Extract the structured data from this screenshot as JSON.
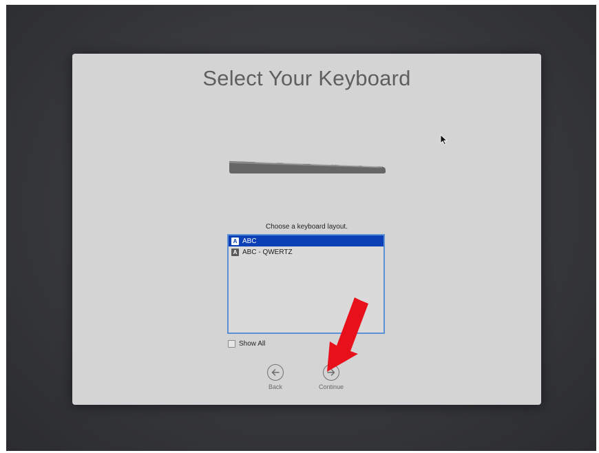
{
  "dialog": {
    "title": "Select Your Keyboard",
    "prompt": "Choose a keyboard layout.",
    "layouts": [
      {
        "label": "ABC",
        "icon": "input-source-icon",
        "icon_glyph": "A",
        "selected": true
      },
      {
        "label": "ABC - QWERTZ",
        "icon": "input-source-icon",
        "icon_glyph": "A",
        "selected": false
      }
    ],
    "show_all": {
      "label": "Show All",
      "checked": false
    },
    "back_label": "Back",
    "continue_label": "Continue"
  },
  "colors": {
    "selection": "#0b3fb5",
    "list_border": "#5b8fd6",
    "annotation_arrow": "#e8101a"
  }
}
